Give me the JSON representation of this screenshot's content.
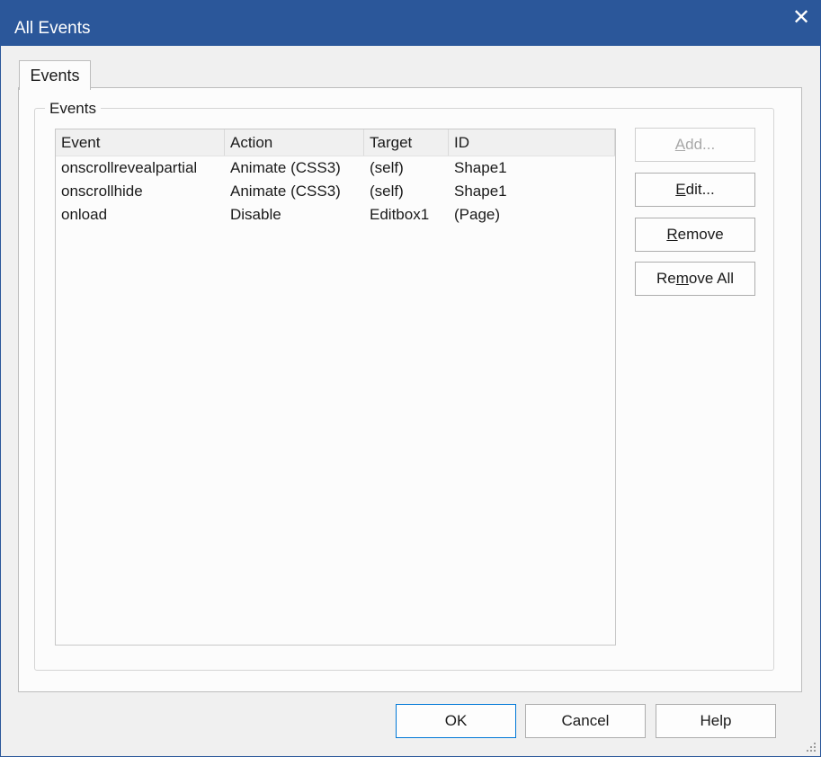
{
  "window": {
    "title": "All Events",
    "close_glyph": "✕"
  },
  "tabs": [
    {
      "label": "Events"
    }
  ],
  "group": {
    "label": "Events"
  },
  "list": {
    "columns": [
      "Event",
      "Action",
      "Target",
      "ID"
    ],
    "rows": [
      [
        "onscrollrevealpartial",
        "Animate (CSS3)",
        "(self)",
        "Shape1"
      ],
      [
        "onscrollhide",
        "Animate (CSS3)",
        "(self)",
        "Shape1"
      ],
      [
        "onload",
        "Disable",
        "Editbox1",
        "(Page)"
      ]
    ]
  },
  "side_buttons": {
    "add": {
      "pre": "",
      "key": "A",
      "post": "dd..."
    },
    "edit": {
      "pre": "",
      "key": "E",
      "post": "dit..."
    },
    "remove": {
      "pre": "",
      "key": "R",
      "post": "emove"
    },
    "remove_all": {
      "pre": "Re",
      "key": "m",
      "post": "ove All"
    }
  },
  "footer": {
    "ok": "OK",
    "cancel": "Cancel",
    "help": "Help"
  },
  "colors": {
    "titlebar": "#2b579a",
    "default_button_border": "#0078d7",
    "dialog_bg": "#f0f0f0"
  }
}
